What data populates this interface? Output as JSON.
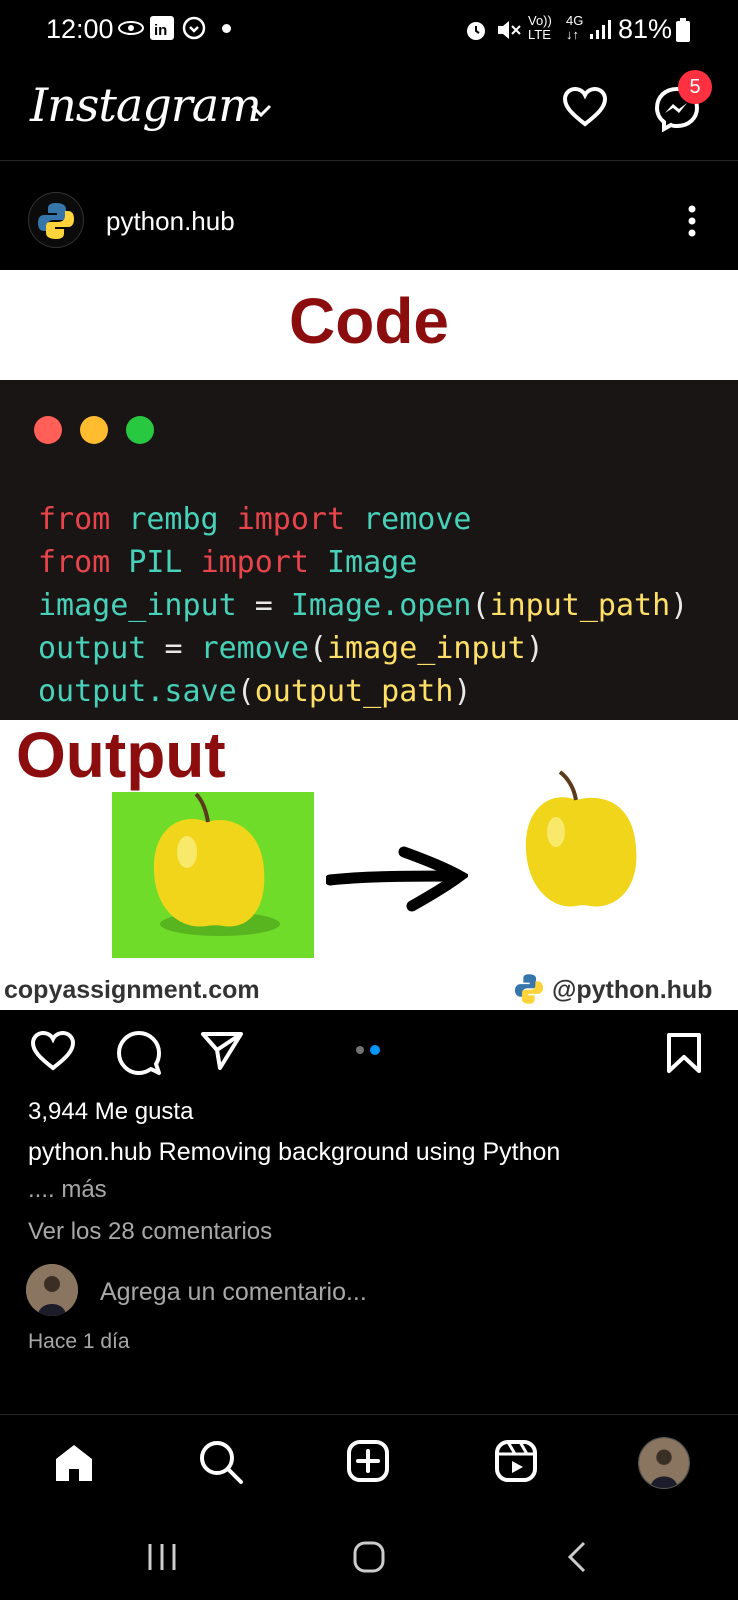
{
  "status_bar": {
    "time": "12:00",
    "battery": "81%",
    "network": "4G",
    "lte": "LTE",
    "volte": "Vo))"
  },
  "header": {
    "logo": "Instagram",
    "badge_count": "5"
  },
  "post": {
    "username": "python.hub",
    "image": {
      "code_title": "Code",
      "output_title": "Output",
      "code_lines": [
        "from rembg import remove",
        "from PIL import Image",
        "image_input = Image.open(input_path)",
        "output = remove(image_input)",
        "output.save(output_path)"
      ],
      "watermark_left": "copyassignment.com",
      "watermark_right": "@python.hub"
    },
    "likes": "3,944 Me gusta",
    "caption_user": "python.hub",
    "caption_text": "Removing background using Python",
    "more": ".... más",
    "view_comments": "Ver los 28 comentarios",
    "add_comment_placeholder": "Agrega un comentario...",
    "time_ago": "Hace 1 día"
  },
  "colors": {
    "accent_badge": "#ff3040",
    "carousel_active": "#0095f6",
    "title_red": "#8b0d0d"
  },
  "nav": {
    "items": [
      "home-icon",
      "search-icon",
      "create-icon",
      "reels-icon",
      "profile-avatar"
    ]
  }
}
